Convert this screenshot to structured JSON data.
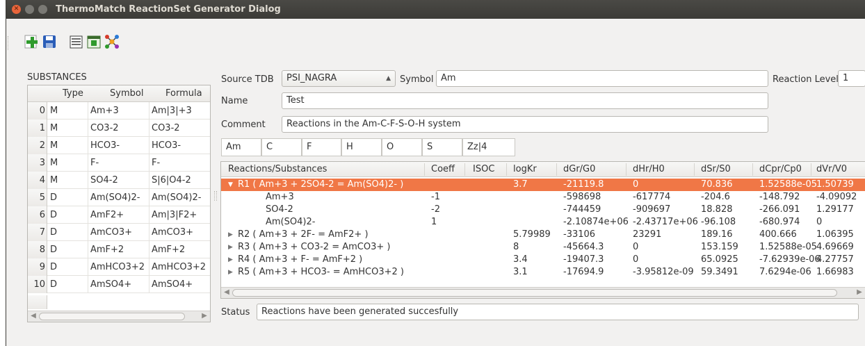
{
  "window": {
    "title": "ThermoMatch ReactionSet Generator Dialog",
    "controls": [
      "close-icon",
      "minimize-icon",
      "maximize-icon"
    ]
  },
  "toolbar": {
    "buttons": [
      "add-icon",
      "save-icon",
      "list-icon",
      "table-icon",
      "network-icon"
    ]
  },
  "substances": {
    "title": "SUBSTANCES",
    "headers": [
      "Type",
      "Symbol",
      "Formula"
    ],
    "rows": [
      {
        "idx": "0",
        "type": "M",
        "symbol": "Am+3",
        "formula": "Am|3|+3"
      },
      {
        "idx": "1",
        "type": "M",
        "symbol": "CO3-2",
        "formula": "CO3-2"
      },
      {
        "idx": "2",
        "type": "M",
        "symbol": "HCO3-",
        "formula": "HCO3-"
      },
      {
        "idx": "3",
        "type": "M",
        "symbol": "F-",
        "formula": "F-"
      },
      {
        "idx": "4",
        "type": "M",
        "symbol": "SO4-2",
        "formula": "S|6|O4-2"
      },
      {
        "idx": "5",
        "type": "D",
        "symbol": "Am(SO4)2-",
        "formula": "Am(SO4)2-"
      },
      {
        "idx": "6",
        "type": "D",
        "symbol": "AmF2+",
        "formula": "Am|3|F2+"
      },
      {
        "idx": "7",
        "type": "D",
        "symbol": "AmCO3+",
        "formula": "AmCO3+"
      },
      {
        "idx": "8",
        "type": "D",
        "symbol": "AmF+2",
        "formula": "AmF+2"
      },
      {
        "idx": "9",
        "type": "D",
        "symbol": "AmHCO3+2",
        "formula": "AmHCO3+2"
      },
      {
        "idx": "10",
        "type": "D",
        "symbol": "AmSO4+",
        "formula": "AmSO4+"
      }
    ]
  },
  "form": {
    "source_tdb_label": "Source TDB",
    "source_tdb_value": "PSI_NAGRA",
    "symbol_label": "Symbol",
    "symbol_value": "Am",
    "reaction_level_label": "Reaction Level",
    "reaction_level_value": "1",
    "name_label": "Name",
    "name_value": "Test",
    "comment_label": "Comment",
    "comment_value": "Reactions in the Am-C-F-S-O-H system"
  },
  "elements": [
    "Am",
    "C",
    "F",
    "H",
    "O",
    "S",
    "Zz|4"
  ],
  "reactions": {
    "headers": [
      "Reactions/Substances",
      "Coeff",
      "ISOC",
      "logKr",
      "dGr/G0",
      "dHr/H0",
      "dSr/S0",
      "dCpr/Cp0",
      "dVr/V0"
    ],
    "rows": [
      {
        "kind": "reaction",
        "expanded": true,
        "selected": true,
        "name": "R1 ( Am+3 + 2SO4-2 = Am(SO4)2- )",
        "coeff": "",
        "isoc": "",
        "logk": "3.7",
        "dg": "-21119.8",
        "dh": "0",
        "ds": "70.836",
        "dcp": "1.52588e-05",
        "dv": "1.50739"
      },
      {
        "kind": "substance",
        "name": "Am+3",
        "coeff": "-1",
        "isoc": "",
        "logk": "",
        "dg": "-598698",
        "dh": "-617774",
        "ds": "-204.6",
        "dcp": "-148.792",
        "dv": "-4.09092"
      },
      {
        "kind": "substance",
        "name": "SO4-2",
        "coeff": "-2",
        "isoc": "",
        "logk": "",
        "dg": "-744459",
        "dh": "-909697",
        "ds": "18.828",
        "dcp": "-266.091",
        "dv": "1.29177"
      },
      {
        "kind": "substance",
        "name": "Am(SO4)2-",
        "coeff": "1",
        "isoc": "",
        "logk": "",
        "dg": "-2.10874e+06",
        "dh": "-2.43717e+06",
        "ds": "-96.108",
        "dcp": "-680.974",
        "dv": "0"
      },
      {
        "kind": "reaction",
        "expanded": false,
        "name": "R2 ( Am+3 + 2F- = AmF2+ )",
        "coeff": "",
        "isoc": "",
        "logk": "5.79989",
        "dg": "-33106",
        "dh": "23291",
        "ds": "189.16",
        "dcp": "400.666",
        "dv": "1.06395"
      },
      {
        "kind": "reaction",
        "expanded": false,
        "name": "R3 ( Am+3 + CO3-2 = AmCO3+ )",
        "coeff": "",
        "isoc": "",
        "logk": "8",
        "dg": "-45664.3",
        "dh": "0",
        "ds": "153.159",
        "dcp": "1.52588e-05",
        "dv": "4.69669"
      },
      {
        "kind": "reaction",
        "expanded": false,
        "name": "R4 ( Am+3 + F- = AmF+2 )",
        "coeff": "",
        "isoc": "",
        "logk": "3.4",
        "dg": "-19407.3",
        "dh": "0",
        "ds": "65.0925",
        "dcp": "-7.62939e-06",
        "dv": "4.27757"
      },
      {
        "kind": "reaction",
        "expanded": false,
        "name": "R5 ( Am+3 + HCO3- = AmHCO3+2 )",
        "coeff": "",
        "isoc": "",
        "logk": "3.1",
        "dg": "-17694.9",
        "dh": "-3.95812e-09",
        "ds": "59.3491",
        "dcp": "7.6294e-06",
        "dv": "1.66983"
      }
    ]
  },
  "status": {
    "label": "Status",
    "value": "Reactions have been generated succesfully"
  },
  "colors": {
    "selection": "#f07746",
    "titlebar": "#3c3b37",
    "close_button": "#e9653b"
  }
}
